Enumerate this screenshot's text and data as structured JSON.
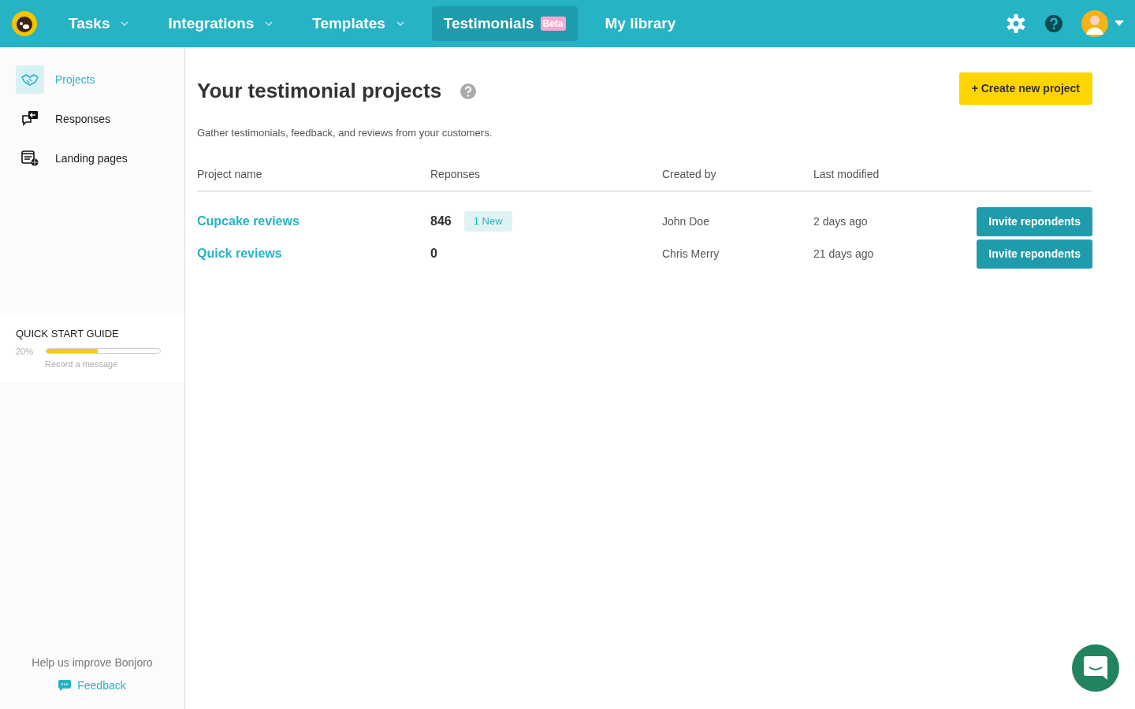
{
  "navbar": {
    "items": [
      {
        "label": "Tasks",
        "dropdown": true,
        "selected": false
      },
      {
        "label": "Integrations",
        "dropdown": true,
        "selected": false
      },
      {
        "label": "Templates",
        "dropdown": true,
        "selected": false
      },
      {
        "label": "Testimonials",
        "dropdown": false,
        "selected": true,
        "badge": "Beta"
      },
      {
        "label": "My library",
        "dropdown": false,
        "selected": false
      }
    ]
  },
  "sidebar": {
    "items": [
      {
        "label": "Projects",
        "kind": "projects",
        "selected": true
      },
      {
        "label": "Responses",
        "kind": "responses",
        "selected": false
      },
      {
        "label": "Landing pages",
        "kind": "landing",
        "selected": false
      }
    ],
    "quick_start": {
      "title": "QUICK START GUIDE",
      "percent": "20%",
      "level": 0.45,
      "step": "Record a message"
    },
    "help_text": "Help us improve Bonjoro",
    "feedback_link": "Feedback"
  },
  "page": {
    "title": "Your testimonial projects",
    "subtitle": "Gather testimonials, feedback, and reviews from your customers.",
    "create_button": "+ Create new project"
  },
  "table": {
    "columns": [
      "Project name",
      "Reponses",
      "Created by",
      "Last modified"
    ],
    "rows": [
      {
        "name": "Cupcake reviews",
        "responses": "846",
        "new_badge": "1 New",
        "created_by": "John Doe",
        "last_modified": "2 days ago",
        "action": "Invite repondents"
      },
      {
        "name": "Quick reviews",
        "responses": "0",
        "created_by": "Chris Merry",
        "last_modified": "21 days ago",
        "action": "Invite repondents"
      }
    ]
  }
}
